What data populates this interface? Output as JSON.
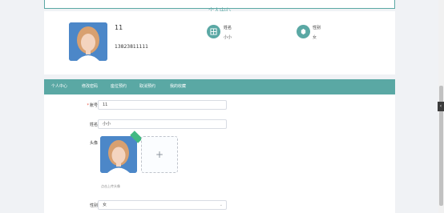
{
  "header": {
    "title": "个人中心"
  },
  "profile": {
    "username": "11",
    "phone": "13823811111",
    "name_label": "姓名",
    "name_value": "小小",
    "gender_label": "性别",
    "gender_value": "女"
  },
  "nav": {
    "items": [
      {
        "label": "个人中心"
      },
      {
        "label": "修改密码"
      },
      {
        "label": "座位预约"
      },
      {
        "label": "取消预约"
      },
      {
        "label": "我的收藏"
      }
    ]
  },
  "form": {
    "account_label": "账号",
    "account_value": "11",
    "name_label": "姓名",
    "name_value": "小小",
    "avatar_label": "头像",
    "upload_tip": "点击上传头像",
    "gender_label": "性别",
    "gender_value": "女"
  },
  "colors": {
    "accent": "#5aa8a4",
    "success": "#42b983"
  },
  "icons": {
    "name": "user-card-icon",
    "gender": "gender-icon",
    "add": "plus-icon",
    "select": "chevron-down-icon"
  },
  "side_tab": "‹"
}
